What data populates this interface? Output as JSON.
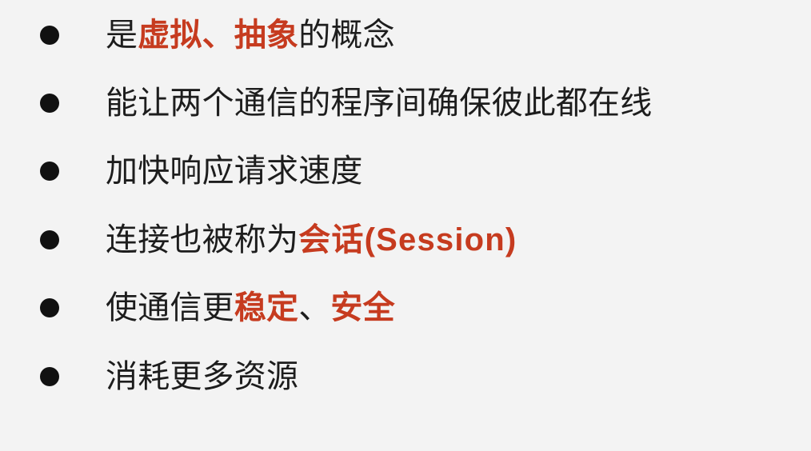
{
  "colors": {
    "background": "#f3f3f3",
    "text": "#1d1d1d",
    "emphasis": "#c63b1f",
    "bullet": "#111111"
  },
  "slide": {
    "items": [
      {
        "segments": [
          {
            "text": "是",
            "emphasis": false
          },
          {
            "text": "虚拟、抽象",
            "emphasis": true
          },
          {
            "text": "的概念",
            "emphasis": false
          }
        ]
      },
      {
        "segments": [
          {
            "text": "能让两个通信的程序间确保彼此都在线",
            "emphasis": false
          }
        ]
      },
      {
        "segments": [
          {
            "text": "加快响应请求速度",
            "emphasis": false
          }
        ]
      },
      {
        "segments": [
          {
            "text": "连接也被称为",
            "emphasis": false
          },
          {
            "text": "会话(Session)",
            "emphasis": true
          }
        ]
      },
      {
        "segments": [
          {
            "text": "使通信更",
            "emphasis": false
          },
          {
            "text": "稳定",
            "emphasis": true
          },
          {
            "text": "、",
            "emphasis": false
          },
          {
            "text": "安全",
            "emphasis": true
          }
        ]
      },
      {
        "segments": [
          {
            "text": "消耗更多资源",
            "emphasis": false
          }
        ]
      }
    ]
  }
}
